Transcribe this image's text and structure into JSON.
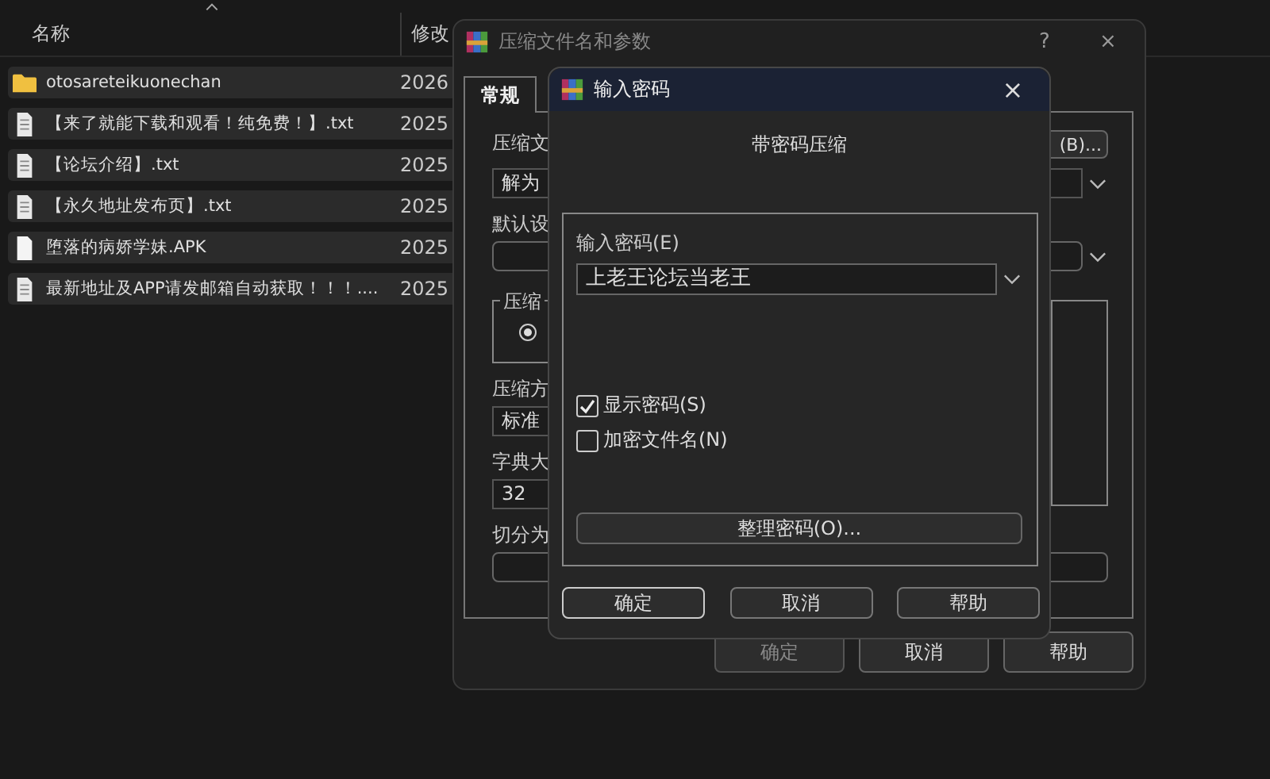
{
  "explorer": {
    "columns": [
      {
        "label": "名称"
      },
      {
        "label": "修改"
      }
    ],
    "rows": [
      {
        "kind": "folder",
        "name": "otosareteikuonechan",
        "date": "2026"
      },
      {
        "kind": "text",
        "name": "【来了就能下载和观看！纯免费！】.txt",
        "date": "2025"
      },
      {
        "kind": "text",
        "name": "【论坛介绍】.txt",
        "date": "2025"
      },
      {
        "kind": "text",
        "name": "【永久地址发布页】.txt",
        "date": "2025"
      },
      {
        "kind": "file",
        "name": "堕落的病娇学妹.APK",
        "date": "2025"
      },
      {
        "kind": "text",
        "name": "最新地址及APP请发邮箱自动获取！！！....",
        "date": "2025"
      }
    ]
  },
  "compress_dialog": {
    "title": "压缩文件名和参数",
    "help": "?",
    "close": "×",
    "tabs": [
      {
        "label": "常规",
        "selected": true
      }
    ],
    "archive_name_label": "压缩文",
    "archive_name": "解为",
    "browse_button": "(B)...",
    "profile_label": "默认设",
    "format_group_label": "压缩",
    "format_radio_selected": true,
    "method_label": "压缩方",
    "method": "标准",
    "dict_label": "字典大",
    "dict": "32",
    "split_label": "切分为",
    "buttons": [
      {
        "label": "确定",
        "disabled": true
      },
      {
        "label": "取消",
        "disabled": false
      },
      {
        "label": "帮助",
        "disabled": false
      }
    ]
  },
  "password_dialog": {
    "title": "输入密码",
    "close": "×",
    "heading": "带密码压缩",
    "password_label": "输入密码(E)",
    "password": "上老王论坛当老王",
    "options": [
      {
        "label": "显示密码(S)",
        "checked": true
      },
      {
        "label": "加密文件名(N)",
        "checked": false
      }
    ],
    "organize_button": "整理密码(O)...",
    "buttons": [
      {
        "label": "确定",
        "default": true
      },
      {
        "label": "取消",
        "default": false
      },
      {
        "label": "帮助",
        "default": false
      }
    ]
  }
}
